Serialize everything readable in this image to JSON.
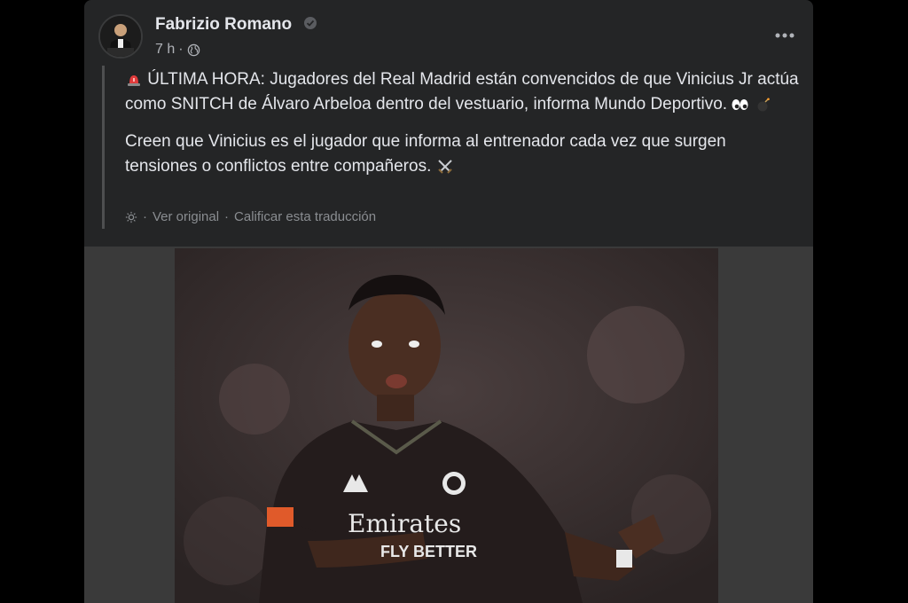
{
  "post": {
    "author": "Fabrizio Romano",
    "time": "7 h",
    "dot": "·",
    "paragraphs": [
      "ÚLTIMA HORA: Jugadores del Real Madrid están convencidos de que Vinicius Jr actúa como SNITCH de Álvaro Arbeloa dentro del vestuario, informa Mundo Deportivo.",
      "Creen que Vinicius es el jugador que informa al entrenador cada vez que surgen tensiones o conflictos entre compañeros."
    ],
    "translation": {
      "see_original": "Ver original",
      "separator": "·",
      "rate": "Calificar esta traducción"
    }
  },
  "photo": {
    "kit_sponsor": "Emirates",
    "kit_sponsor_line2": "FLY BETTER"
  },
  "colors": {
    "background": "#000000",
    "card": "#242526",
    "primary_text": "#e4e6eb",
    "secondary_text": "#b0b3b8",
    "muted_text": "#8a8d91"
  },
  "icons": [
    "avatar",
    "verified-badge-icon",
    "globe-icon",
    "more-options-icon",
    "siren-emoji-icon",
    "eyes-emoji-icon",
    "bomb-emoji-icon",
    "crossed-swords-emoji-icon",
    "translate-gear-icon"
  ]
}
